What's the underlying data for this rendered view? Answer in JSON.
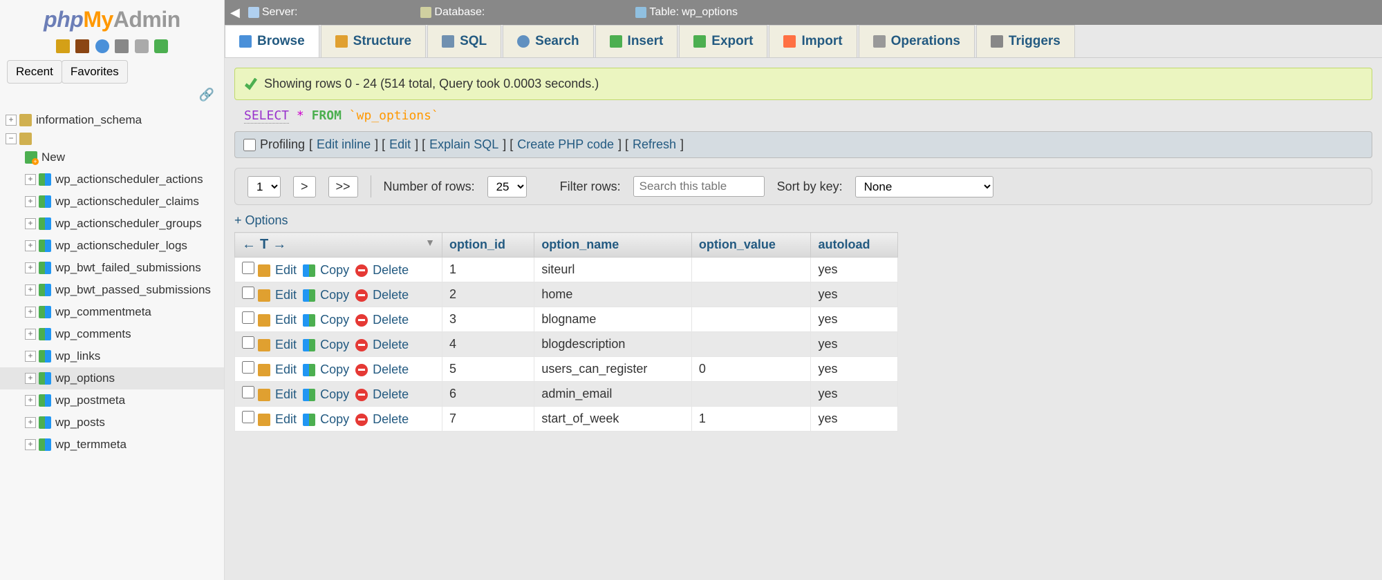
{
  "logo": {
    "php": "php",
    "my": "My",
    "admin": "Admin"
  },
  "sidebar_tabs": {
    "recent": "Recent",
    "favorites": "Favorites"
  },
  "tree": {
    "db1": "information_schema",
    "new": "New",
    "tables": [
      "wp_actionscheduler_actions",
      "wp_actionscheduler_claims",
      "wp_actionscheduler_groups",
      "wp_actionscheduler_logs",
      "wp_bwt_failed_submissions",
      "wp_bwt_passed_submissions",
      "wp_commentmeta",
      "wp_comments",
      "wp_links",
      "wp_options",
      "wp_postmeta",
      "wp_posts",
      "wp_termmeta"
    ]
  },
  "breadcrumb": {
    "server_label": "Server:",
    "server_value": "",
    "db_label": "Database:",
    "db_value": "",
    "table_label": "Table:",
    "table_value": "wp_options"
  },
  "tabs": {
    "browse": "Browse",
    "structure": "Structure",
    "sql": "SQL",
    "search": "Search",
    "insert": "Insert",
    "export": "Export",
    "import": "Import",
    "operations": "Operations",
    "triggers": "Triggers"
  },
  "success_msg": "Showing rows 0 - 24 (514 total, Query took 0.0003 seconds.)",
  "query": {
    "select": "SELECT",
    "star": "*",
    "from": "FROM",
    "table": "`wp_options`"
  },
  "toolbar": {
    "profiling": "Profiling",
    "edit_inline": "Edit inline",
    "edit": "Edit",
    "explain_sql": "Explain SQL",
    "create_php": "Create PHP code",
    "refresh": "Refresh"
  },
  "pager": {
    "page": "1",
    "next": ">",
    "last": ">>",
    "numrows_label": "Number of rows:",
    "numrows": "25",
    "filter_label": "Filter rows:",
    "filter_placeholder": "Search this table",
    "sort_label": "Sort by key:",
    "sort_value": "None"
  },
  "options_link": "+ Options",
  "columns": {
    "option_id": "option_id",
    "option_name": "option_name",
    "option_value": "option_value",
    "autoload": "autoload"
  },
  "actions": {
    "edit": "Edit",
    "copy": "Copy",
    "delete": "Delete"
  },
  "rows": [
    {
      "id": "1",
      "name": "siteurl",
      "value": "",
      "autoload": "yes"
    },
    {
      "id": "2",
      "name": "home",
      "value": "",
      "autoload": "yes"
    },
    {
      "id": "3",
      "name": "blogname",
      "value": "",
      "autoload": "yes"
    },
    {
      "id": "4",
      "name": "blogdescription",
      "value": "",
      "autoload": "yes"
    },
    {
      "id": "5",
      "name": "users_can_register",
      "value": "0",
      "autoload": "yes"
    },
    {
      "id": "6",
      "name": "admin_email",
      "value": "",
      "autoload": "yes"
    },
    {
      "id": "7",
      "name": "start_of_week",
      "value": "1",
      "autoload": "yes"
    }
  ]
}
